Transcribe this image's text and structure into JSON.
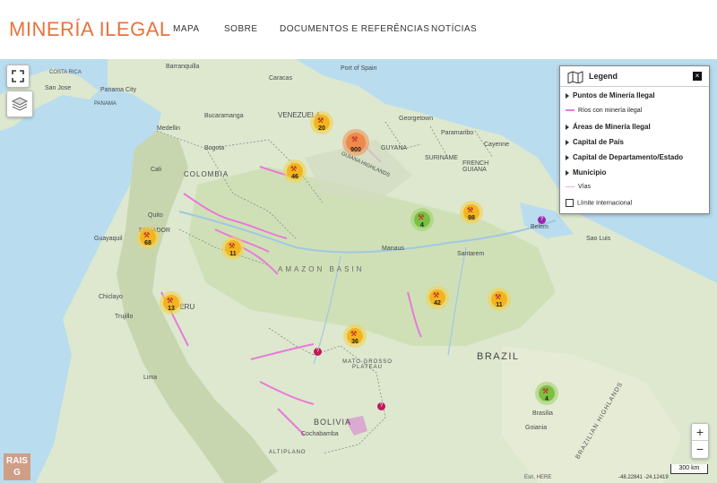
{
  "header": {
    "logo_text": "MINERÍA ILEGAL",
    "nav": [
      "MAPA",
      "SOBRE",
      "DOCUMENTOS E REFERÊNCIAS",
      "NOTÍCIAS"
    ]
  },
  "legend": {
    "title": "Legend",
    "items": [
      {
        "label": "Puntos de Minería Ilegal",
        "type": "group"
      },
      {
        "label": "Ríos con minería ilegal",
        "type": "line",
        "color": "#e87ad8"
      },
      {
        "label": "Áreas de Minería Ilegal",
        "type": "group"
      },
      {
        "label": "Capital de País",
        "type": "group"
      },
      {
        "label": "Capital de Departamento/Estado",
        "type": "group"
      },
      {
        "label": "Municipio",
        "type": "group"
      },
      {
        "label": "Vías",
        "type": "line",
        "color": "#e8b4d8"
      },
      {
        "label": "Límite Internacional",
        "type": "checkbox"
      }
    ]
  },
  "clusters": [
    {
      "count": "20",
      "color": "yellow"
    },
    {
      "count": "900",
      "color": "orange"
    },
    {
      "count": "46",
      "color": "yellow"
    },
    {
      "count": "4",
      "color": "green"
    },
    {
      "count": "98",
      "color": "yellow"
    },
    {
      "count": "68",
      "color": "yellow"
    },
    {
      "count": "11",
      "color": "yellow"
    },
    {
      "count": "13",
      "color": "yellow"
    },
    {
      "count": "42",
      "color": "yellow"
    },
    {
      "count": "11",
      "color": "yellow"
    },
    {
      "count": "36",
      "color": "yellow"
    },
    {
      "count": "4",
      "color": "green"
    }
  ],
  "map_labels": {
    "venezuela": "VENEZUELA",
    "colombia": "COLOMBIA",
    "guyana": "GUYANA",
    "suriname": "SURINAME",
    "french_guiana": "FRENCH GUIANA",
    "ecuador": "ECUADOR",
    "peru": "PERU",
    "brazil": "BRAZIL",
    "bolivia": "BOLIVIA",
    "amazon_basin": "AMAZON BASIN",
    "mato_grosso": "MATO GROSSO PLATEAU",
    "brazilian_highlands": "BRAZILIAN HIGHLANDS",
    "guiana_highlands": "GUIANA HIGHLANDS",
    "altiplano": "ALTIPLANO",
    "costa_rica": "COSTA RICA",
    "panama": "PANAMA",
    "cities": [
      "San Jose",
      "Panama City",
      "Caracas",
      "Georgetown",
      "Paramaribo",
      "Cayenne",
      "Medellin",
      "Bogota",
      "Quito",
      "Guayaquil",
      "Manaus",
      "Belem",
      "Sao Luis",
      "Chiclayo",
      "Trujillo",
      "Lima",
      "Cochabamba",
      "Brasilia",
      "Goiania",
      "Port of Spain",
      "Barranquilla",
      "Bucaramanga",
      "Cali",
      "Santarem"
    ]
  },
  "scale": "300 km",
  "watermark": "RAISG",
  "zoom_in": "+",
  "zoom_out": "−",
  "coords": "-48.22841 -24.12419",
  "attribution": "Esri, HERE"
}
